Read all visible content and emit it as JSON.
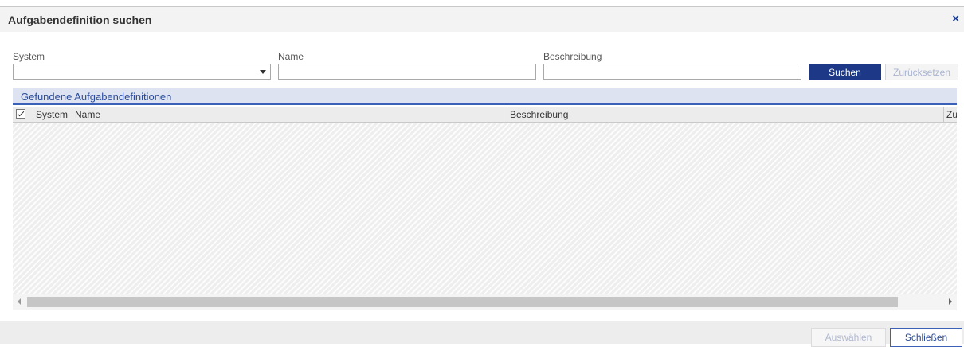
{
  "dialog": {
    "title": "Aufgabendefinition suchen",
    "close_icon": "×"
  },
  "search": {
    "system_label": "System",
    "system_value": "",
    "name_label": "Name",
    "name_value": "",
    "beschreibung_label": "Beschreibung",
    "beschreibung_value": "",
    "search_button": "Suchen",
    "reset_button": "Zurücksetzen"
  },
  "results": {
    "title": "Gefundene Aufgabendefinitionen",
    "columns": [
      "System",
      "Name",
      "Beschreibung",
      "Zu"
    ],
    "rows": []
  },
  "footer": {
    "select_button": "Auswählen",
    "close_button": "Schließen"
  },
  "colors": {
    "primary": "#1c3887",
    "header_bg": "#dde3f0",
    "accent": "#3a61b5"
  }
}
